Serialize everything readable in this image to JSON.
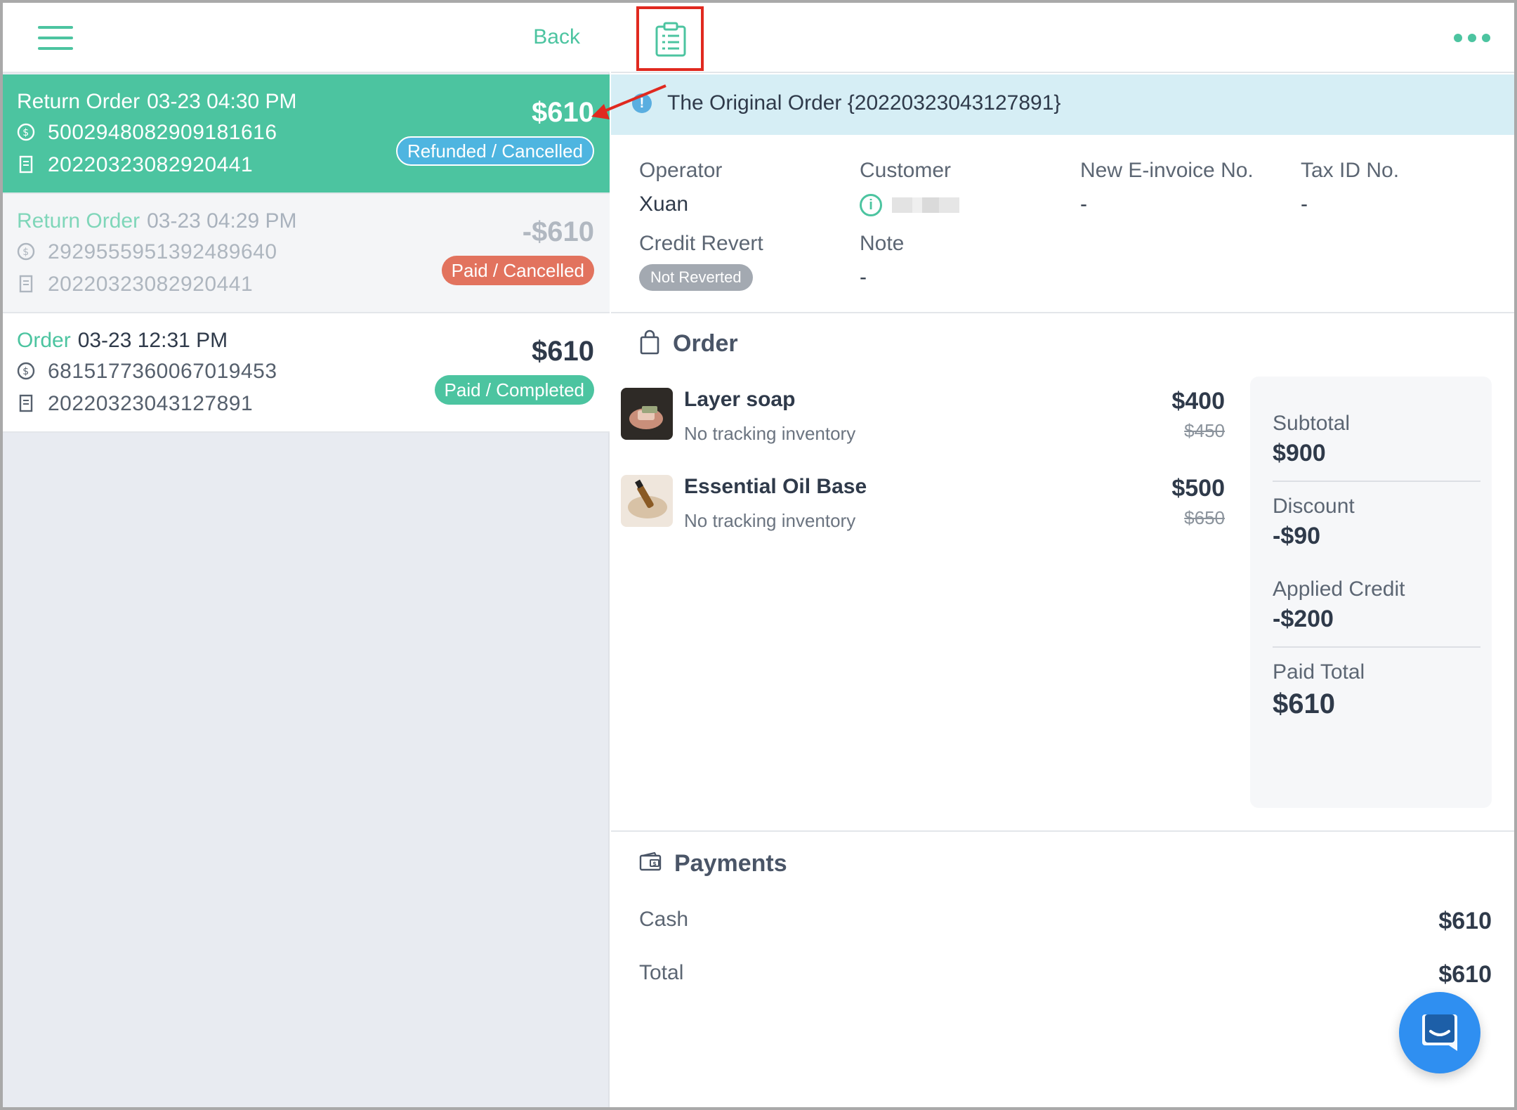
{
  "left_header": {
    "back_label": "Back",
    "menu_icon": "hamburger-icon"
  },
  "orders": [
    {
      "type": "Return Order",
      "time": "03-23 04:30 PM",
      "payment_id": "5002948082909181616",
      "invoice_no": "20220323082920441",
      "amount": "$610",
      "status": "Refunded / Cancelled",
      "state": "active"
    },
    {
      "type": "Return Order",
      "time": "03-23 04:29 PM",
      "payment_id": "2929555951392489640",
      "invoice_no": "20220323082920441",
      "amount": "-$610",
      "status": "Paid / Cancelled",
      "state": "muted"
    },
    {
      "type": "Order",
      "time": "03-23 12:31 PM",
      "payment_id": "6815177360067019453",
      "invoice_no": "20220323043127891",
      "amount": "$610",
      "status": "Paid / Completed",
      "state": "normal"
    }
  ],
  "banner": {
    "text": "The Original Order {20220323043127891}"
  },
  "info": {
    "operator_label": "Operator",
    "operator_value": "Xuan",
    "customer_label": "Customer",
    "einvoice_label": "New E-invoice No.",
    "einvoice_value": "-",
    "taxid_label": "Tax ID No.",
    "taxid_value": "-",
    "credit_label": "Credit Revert",
    "credit_value": "Not Reverted",
    "note_label": "Note",
    "note_value": "-"
  },
  "order_section": {
    "title": "Order",
    "items": [
      {
        "name": "Layer soap",
        "sub": "No tracking inventory",
        "price": "$400",
        "old_price": "$450"
      },
      {
        "name": "Essential Oil Base",
        "sub": "No tracking inventory",
        "price": "$500",
        "old_price": "$650"
      }
    ]
  },
  "summary": {
    "subtotal_label": "Subtotal",
    "subtotal": "$900",
    "discount_label": "Discount",
    "discount": "-$90",
    "credit_label": "Applied Credit",
    "credit": "-$200",
    "paid_label": "Paid Total",
    "paid": "$610"
  },
  "payments": {
    "title": "Payments",
    "rows": [
      {
        "label": "Cash",
        "value": "$610"
      },
      {
        "label": "Total",
        "value": "$610"
      }
    ]
  },
  "colors": {
    "accent": "#4cc4a0",
    "refund_badge": "#4eb5e0",
    "cancel_badge": "#e2735e",
    "highlight": "#e0291f",
    "chat": "#2f8ff1"
  }
}
